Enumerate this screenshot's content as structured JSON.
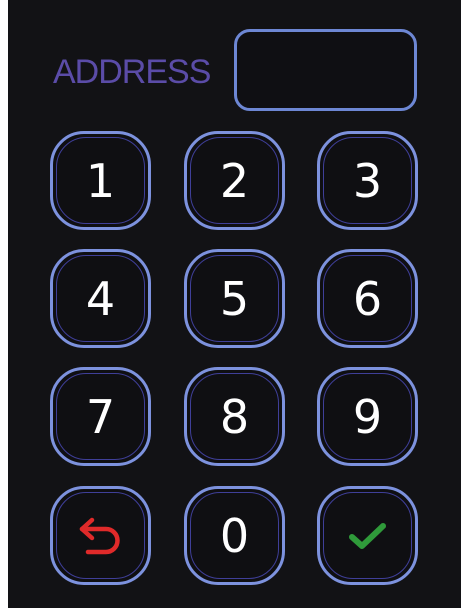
{
  "keypad": {
    "address_label": "ADDRESS",
    "address_value": "",
    "keys": {
      "k1": "1",
      "k2": "2",
      "k3": "3",
      "k4": "4",
      "k5": "5",
      "k6": "6",
      "k7": "7",
      "k8": "8",
      "k9": "9",
      "k0": "0"
    },
    "backspace_icon": "undo-arrow-icon",
    "confirm_icon": "checkmark-icon"
  },
  "colors": {
    "background": "#121215",
    "label": "#5b4ca8",
    "key_border": "#7d92de",
    "backspace": "#e02a2a",
    "confirm": "#2f9a3a"
  }
}
